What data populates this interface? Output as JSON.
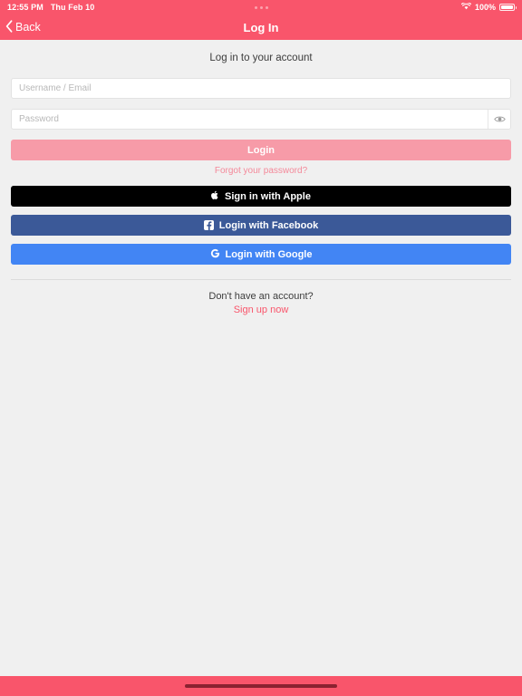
{
  "status_bar": {
    "time": "12:55 PM",
    "date": "Thu Feb 10",
    "battery_percent": "100%",
    "wifi_icon": "wifi-icon",
    "battery_icon": "battery-full-icon",
    "center_dots": "•••"
  },
  "nav": {
    "back_label": "Back",
    "back_icon": "chevron-left-icon",
    "title": "Log In"
  },
  "form": {
    "subtitle": "Log in to your account",
    "username": {
      "placeholder": "Username / Email",
      "value": ""
    },
    "password": {
      "placeholder": "Password",
      "value": "",
      "toggle_icon": "eye-icon"
    },
    "login_button": "Login",
    "forgot_link": "Forgot your password?"
  },
  "social": {
    "apple": {
      "label": "Sign in with Apple",
      "icon": "apple-logo-icon"
    },
    "facebook": {
      "label": "Login with Facebook",
      "icon": "facebook-logo-icon"
    },
    "google": {
      "label": "Login with Google",
      "icon": "google-logo-icon"
    }
  },
  "signup": {
    "question": "Don't have an account?",
    "link": "Sign up now"
  },
  "colors": {
    "brand_pink": "#f9556b",
    "login_disabled_pink": "#f79ba8",
    "link_pink": "#f4899a",
    "apple_black": "#000000",
    "facebook_blue": "#3b5998",
    "google_blue": "#4285f4",
    "page_background": "#f0f0f0"
  }
}
